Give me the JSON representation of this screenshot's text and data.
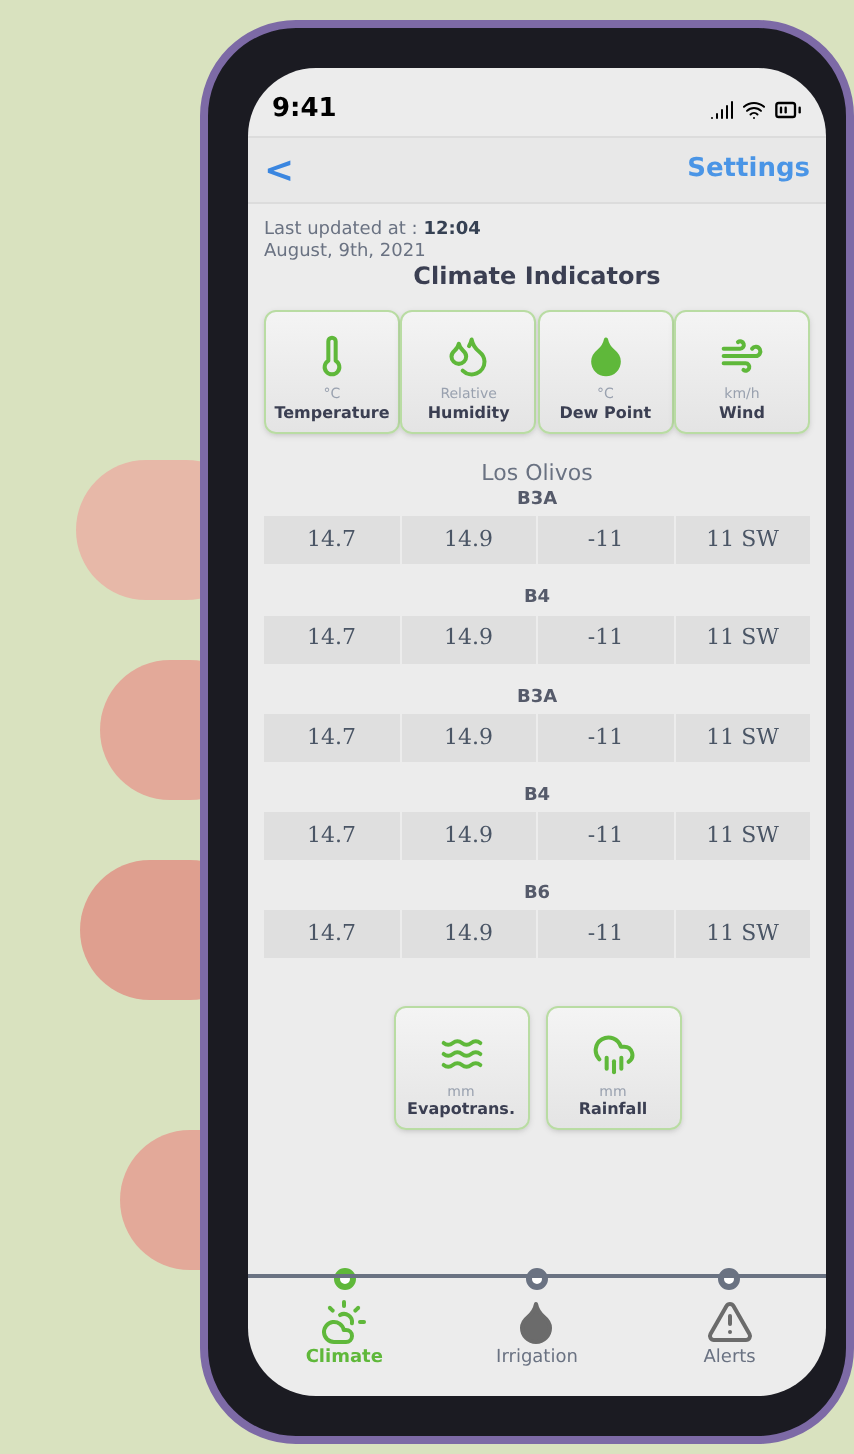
{
  "status_bar": {
    "time": "9:41"
  },
  "header": {
    "back": "<",
    "action": "Settings"
  },
  "updated": {
    "label": "Last updated at : ",
    "time": "12:04",
    "date": "August, 9th,  2021"
  },
  "title": "Climate Indicators",
  "indicators": [
    {
      "kind": "temperature",
      "unit": "°C",
      "label": "Temperature"
    },
    {
      "kind": "humidity",
      "unit": "Relative",
      "label": "Humidity"
    },
    {
      "kind": "dewpoint",
      "unit": "°C",
      "label": "Dew Point"
    },
    {
      "kind": "wind",
      "unit": "km/h",
      "label": "Wind"
    }
  ],
  "location": "Los Olivos",
  "stations": [
    {
      "name": "B3A",
      "values": [
        "14.7",
        "14.9",
        "-11",
        "11 SW"
      ]
    },
    {
      "name": "B4",
      "values": [
        "14.7",
        "14.9",
        "-11",
        "11 SW"
      ]
    },
    {
      "name": "B3A",
      "values": [
        "14.7",
        "14.9",
        "-11",
        "11 SW"
      ]
    },
    {
      "name": "B4",
      "values": [
        "14.7",
        "14.9",
        "-11",
        "11 SW"
      ]
    },
    {
      "name": "B6",
      "values": [
        "14.7",
        "14.9",
        "-11",
        "11 SW"
      ]
    }
  ],
  "extra_indicators": [
    {
      "kind": "evapotranspiration",
      "unit": "mm",
      "label": "Evapotrans."
    },
    {
      "kind": "rainfall",
      "unit": "mm",
      "label": "Rainfall"
    }
  ],
  "tabs": [
    {
      "kind": "climate",
      "label": "Climate",
      "selected": true
    },
    {
      "kind": "irrigation",
      "label": "Irrigation",
      "selected": false
    },
    {
      "kind": "alerts",
      "label": "Alerts",
      "selected": false
    }
  ]
}
